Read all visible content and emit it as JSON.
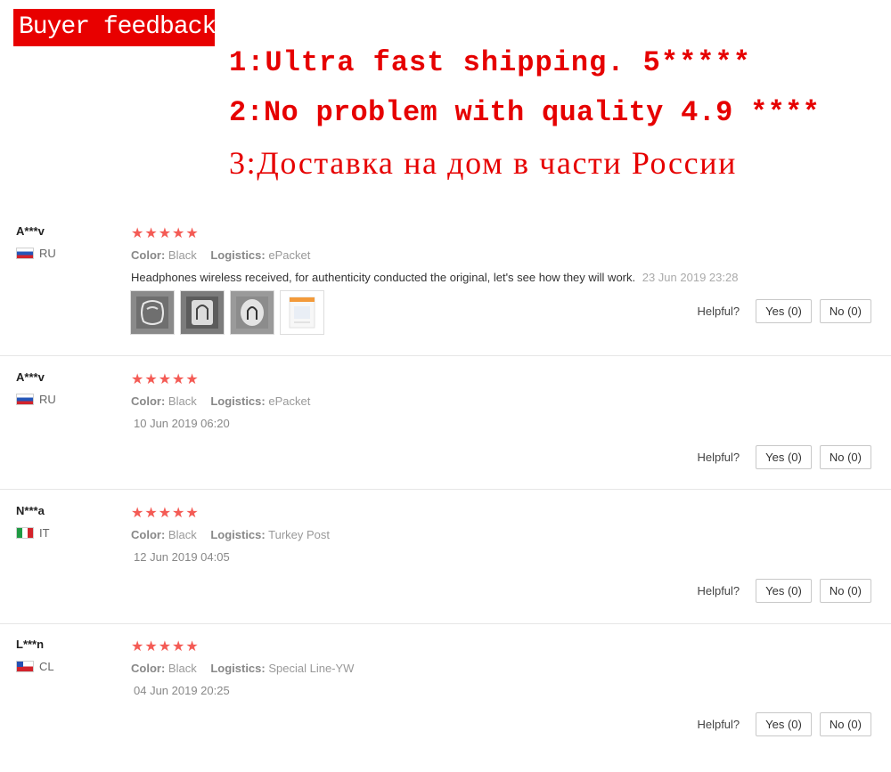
{
  "banner": {
    "title": "Buyer feedback:",
    "lines": [
      "1:Ultra fast shipping. 5*****",
      "2:No problem with quality 4.9 ****",
      "3:Доставка на дом в части России"
    ]
  },
  "helpful_label": "Helpful?",
  "meta_labels": {
    "color": "Color:",
    "logistics": "Logistics:"
  },
  "colors": {
    "star": "#f45b55",
    "promo": "#e60000",
    "banner_bg": "#e80000"
  },
  "reviews": [
    {
      "user": "A***v",
      "country": "RU",
      "stars": "★★★★★",
      "color": "Black",
      "logistics": "ePacket",
      "comment": "Headphones wireless received, for authenticity conducted the original, let's see how they will work.",
      "time": "23 Jun 2019 23:28",
      "thumbnails": [
        "earphones-photo",
        "earphones-photo",
        "earphones-photo",
        "package-photo"
      ],
      "yes": "Yes (0)",
      "no": "No (0)"
    },
    {
      "user": "A***v",
      "country": "RU",
      "stars": "★★★★★",
      "color": "Black",
      "logistics": "ePacket",
      "time": "10 Jun 2019 06:20",
      "yes": "Yes (0)",
      "no": "No (0)"
    },
    {
      "user": "N***a",
      "country": "IT",
      "stars": "★★★★★",
      "color": "Black",
      "logistics": "Turkey Post",
      "time": "12 Jun 2019 04:05",
      "yes": "Yes (0)",
      "no": "No (0)"
    },
    {
      "user": "L***n",
      "country": "CL",
      "stars": "★★★★★",
      "color": "Black",
      "logistics": "Special Line-YW",
      "time": "04 Jun 2019 20:25",
      "yes": "Yes (0)",
      "no": "No (0)"
    }
  ]
}
